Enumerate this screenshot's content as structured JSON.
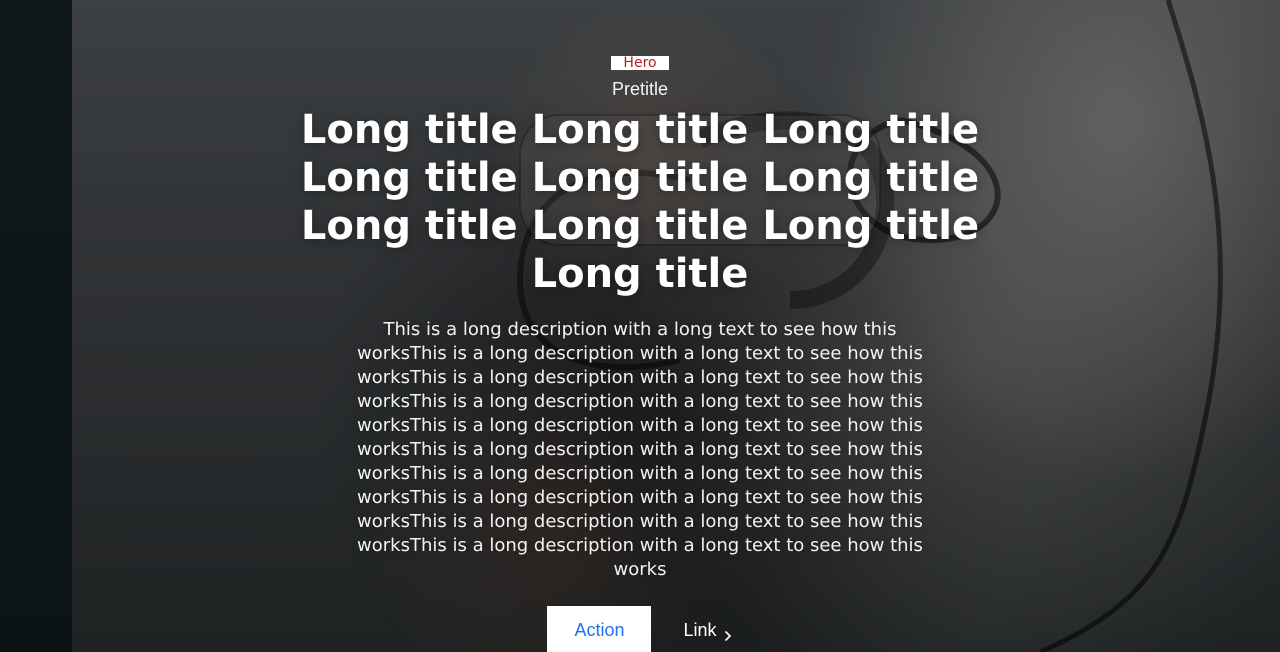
{
  "hero": {
    "badge": "Hero",
    "pretitle": "Pretitle",
    "title": "Long title Long title Long title Long title Long title Long title Long title Long title Long title Long title",
    "description": "This is a long description with a long text to see how this worksThis is a long description with a long text to see how this worksThis is a long description with a long text to see how this worksThis is a long description with a long text to see how this worksThis is a long description with a long text to see how this worksThis is a long description with a long text to see how this worksThis is a long description with a long text to see how this worksThis is a long description with a long text to see how this worksThis is a long description with a long text to see how this worksThis is a long description with a long text to see how this works",
    "actions": {
      "primary_label": "Action",
      "link_label": "Link"
    }
  },
  "icons": {
    "chevron": "chevron-right-icon"
  },
  "colors": {
    "badge_text": "#b22222",
    "primary_button_text": "#1a73e8"
  }
}
